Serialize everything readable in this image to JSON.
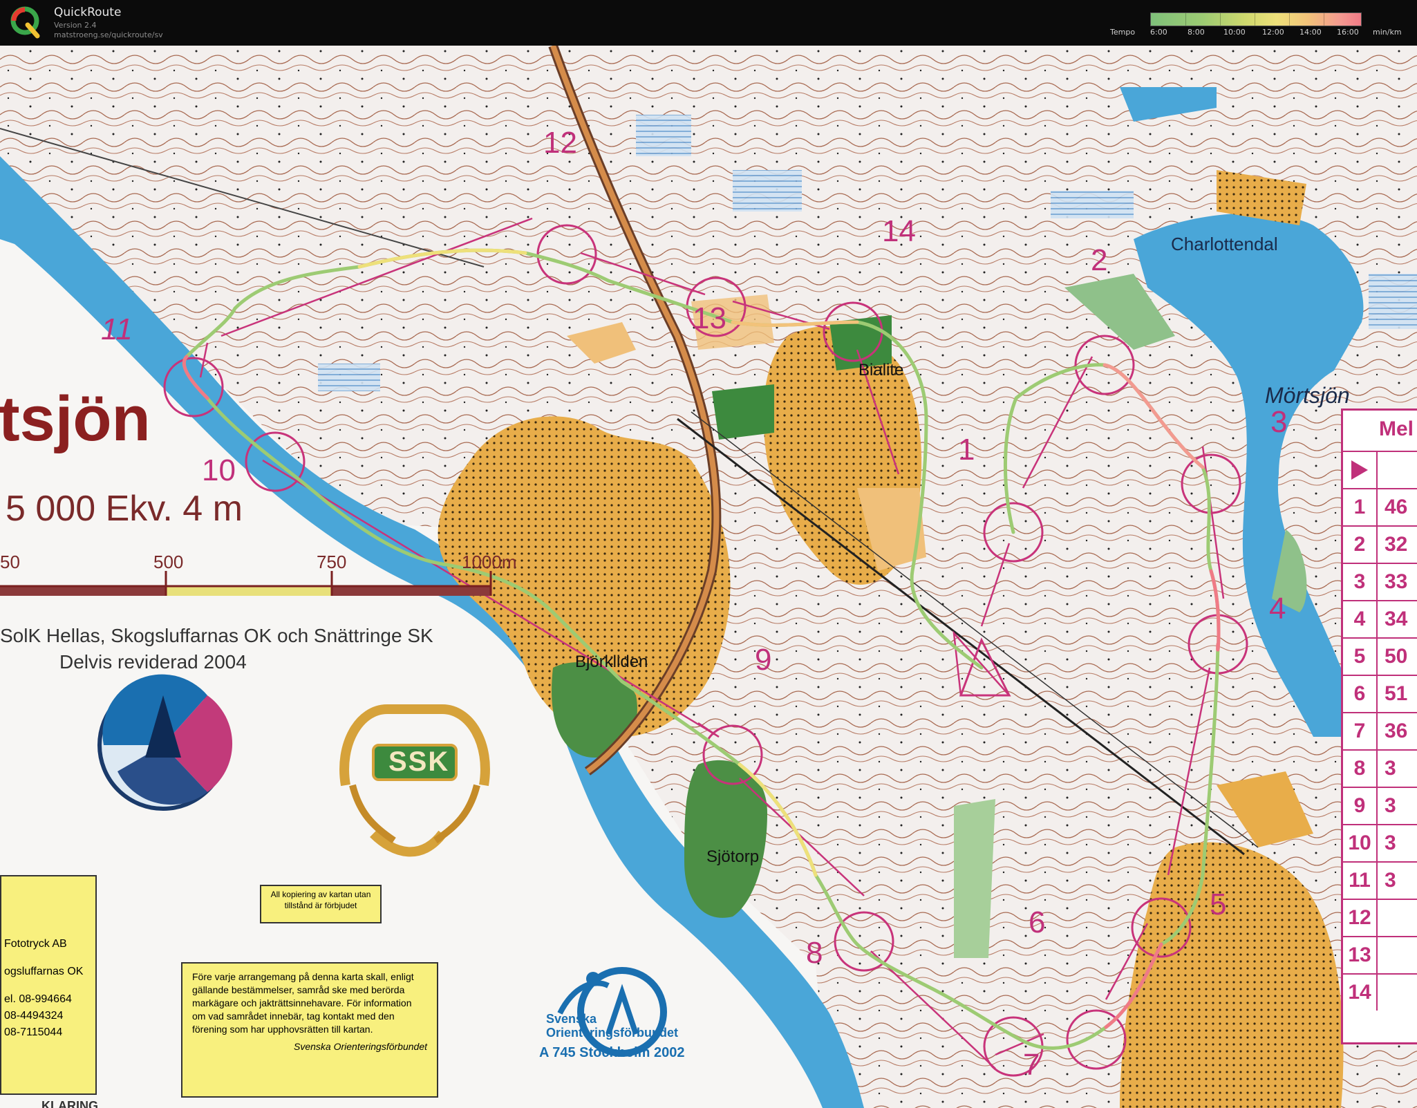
{
  "app": {
    "name": "QuickRoute",
    "version": "Version 2.4",
    "url": "matstroeng.se/quickroute/sv"
  },
  "tempo": {
    "label": "Tempo",
    "ticks": [
      "6:00",
      "8:00",
      "10:00",
      "12:00",
      "14:00",
      "16:00"
    ],
    "unit": "min/km",
    "colors": [
      "#7fc07a",
      "#cfd96e",
      "#eee07a",
      "#f2c27a",
      "#f07a86"
    ]
  },
  "map": {
    "title": "tsjön",
    "scale_text": "5 000 Ekv. 4 m",
    "scale_bar_labels": [
      "50",
      "500",
      "750",
      "1000m"
    ],
    "clubs": "SolK Hellas, Skogsluffarnas OK och Snättringe SK",
    "revised": "Delvis reviderad 2004",
    "ssk_logo_text": "SSK",
    "place_names": {
      "charlottendal": "Charlottendal",
      "mortsjon": "Mörtsjön",
      "bjorkliden": "Björkliden",
      "sjotorp": "Sjötorp",
      "bialite": "Bialite"
    },
    "copy_notice": "All kopiering av kartan utan tillstånd är förbjudet",
    "arrangement_notice": "Före varje arrangemang på denna karta skall, enligt gällande bestämmelser, samråd ske med berörda markägare och jakträttsinnehavare. För information om vad samrådet innebär, tag kontakt med den förening som har upphovsrätten till kartan.",
    "arrangement_sign": "Svenska Orienteringsförbundet",
    "printer_lines": [
      "Fototryck AB",
      "ogsluffarnas OK",
      "el. 08-994664",
      "08-4494324",
      "08-7115044"
    ],
    "sof_name": "Svenska Orienteringsförbundet",
    "sof_code": "A 745 Stockholm 2002",
    "bottom_fragment": "KLARING",
    "control_numbers": [
      "1",
      "2",
      "3",
      "4",
      "5",
      "6",
      "7",
      "8",
      "9",
      "10",
      "11",
      "12",
      "13",
      "14"
    ],
    "table_header": "Mel",
    "table_rows": [
      {
        "n": "",
        "v": ""
      },
      {
        "n": "1",
        "v": "46"
      },
      {
        "n": "2",
        "v": "32"
      },
      {
        "n": "3",
        "v": "33"
      },
      {
        "n": "4",
        "v": "34"
      },
      {
        "n": "5",
        "v": "50"
      },
      {
        "n": "6",
        "v": "51"
      },
      {
        "n": "7",
        "v": "36"
      },
      {
        "n": "8",
        "v": "3"
      },
      {
        "n": "9",
        "v": "3"
      },
      {
        "n": "10",
        "v": "3"
      },
      {
        "n": "11",
        "v": "3"
      },
      {
        "n": "12",
        "v": ""
      },
      {
        "n": "13",
        "v": ""
      },
      {
        "n": "14",
        "v": ""
      }
    ]
  }
}
